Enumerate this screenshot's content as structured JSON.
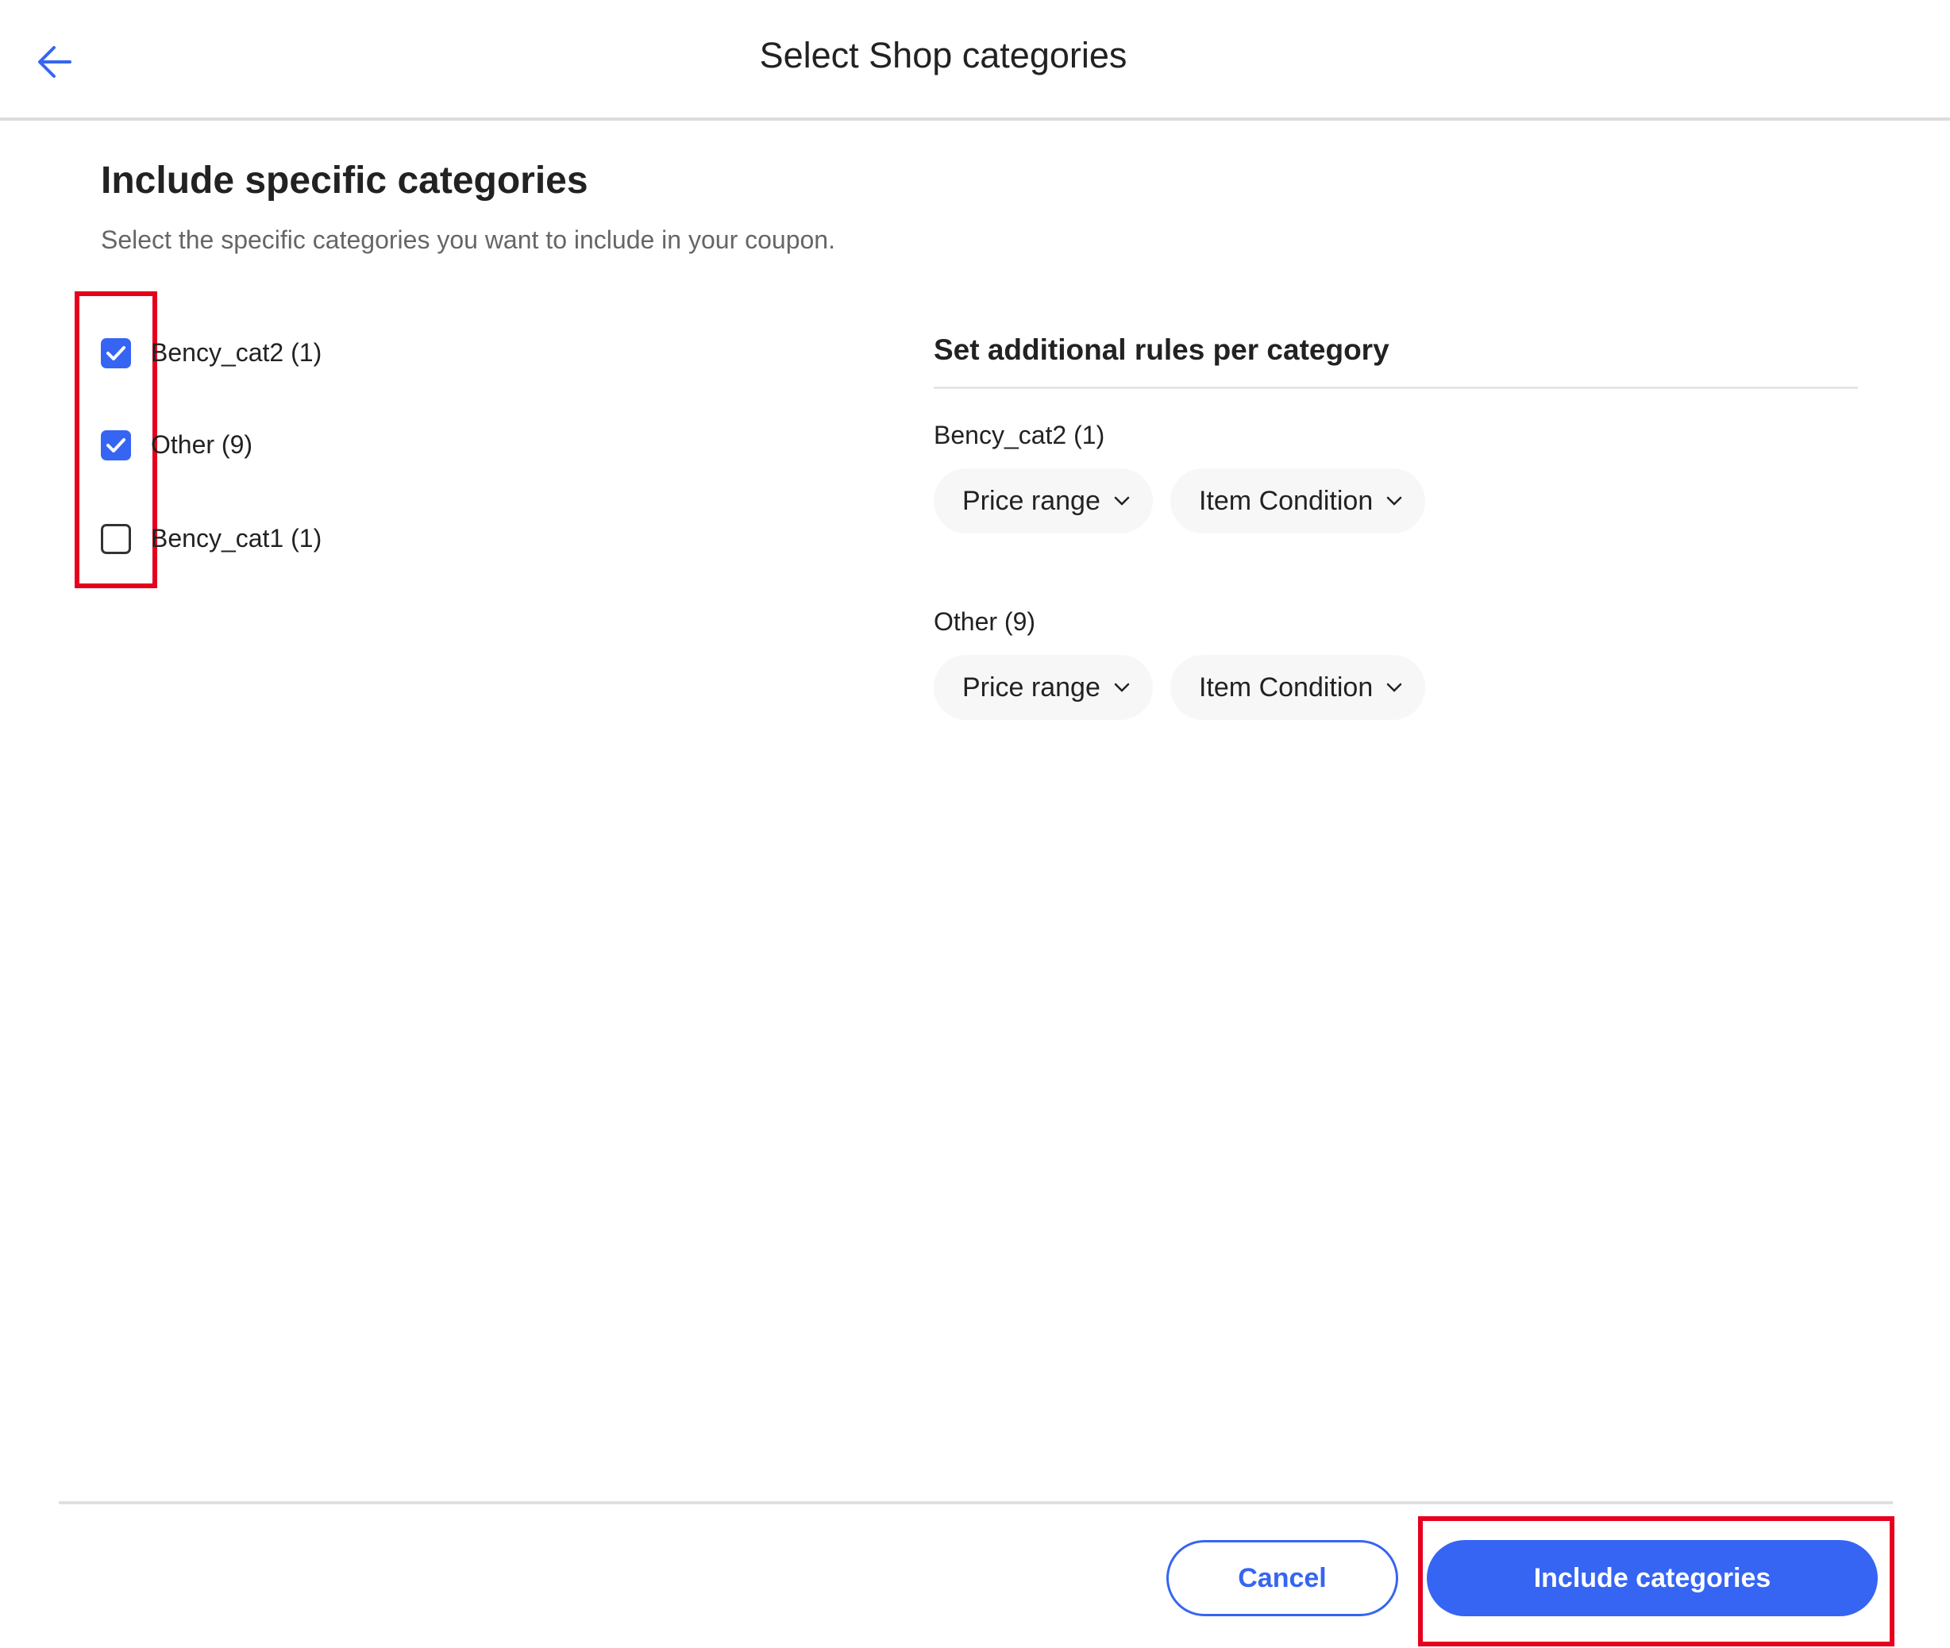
{
  "header": {
    "title": "Select Shop categories",
    "back_icon": "arrow-left-icon"
  },
  "section": {
    "heading": "Include specific categories",
    "subtitle": "Select the specific categories you want to include in your coupon."
  },
  "categories": [
    {
      "label": "Bency_cat2 (1)",
      "checked": true
    },
    {
      "label": "Other (9)",
      "checked": true
    },
    {
      "label": "Bency_cat1 (1)",
      "checked": false
    }
  ],
  "rules": {
    "heading": "Set additional rules per category",
    "groups": [
      {
        "name": "Bency_cat2 (1)",
        "filters": [
          "Price range",
          "Item Condition"
        ]
      },
      {
        "name": "Other (9)",
        "filters": [
          "Price range",
          "Item Condition"
        ]
      }
    ]
  },
  "footer": {
    "cancel_label": "Cancel",
    "include_label": "Include categories"
  },
  "colors": {
    "accent": "#3665f3",
    "highlight": "#e5001e"
  }
}
